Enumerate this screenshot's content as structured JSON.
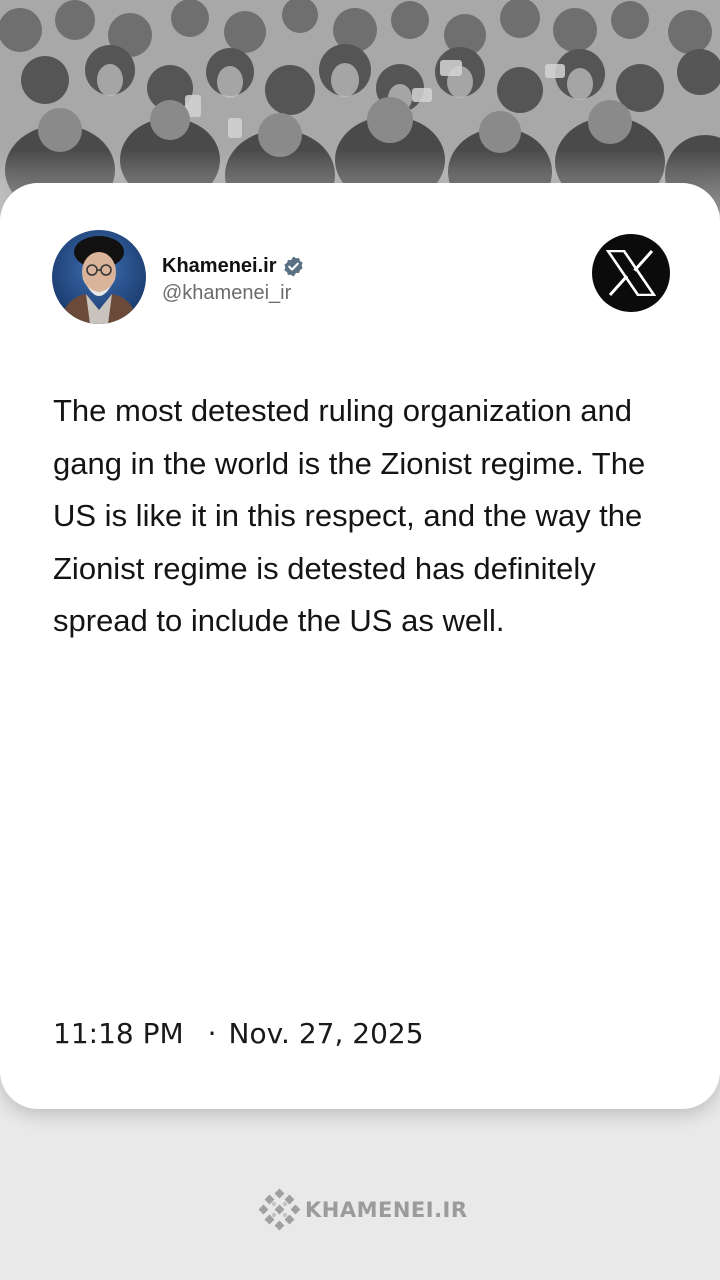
{
  "account": {
    "display_name": "Khamenei.ir",
    "handle": "@khamenei_ir",
    "verified_icon": "verified-badge-icon",
    "verified_color": "#5b7083"
  },
  "platform": {
    "logo_icon": "x-logo-icon"
  },
  "tweet": {
    "text": "The most detested ruling organization and gang in the world is the Zionist regime. The US is like it in this respect, and the way the Zionist regime is detested has definitely spread to include the US as well.",
    "time": "11:18 PM",
    "separator": "·",
    "date": "Nov. 27, 2025"
  },
  "footer": {
    "brand": "KHAMENEI.IR",
    "brand_color": "#9b9b9b"
  },
  "colors": {
    "background": "#e9e9e9",
    "card": "#ffffff",
    "text": "#141414",
    "secondary_text": "#6b6b6b"
  }
}
